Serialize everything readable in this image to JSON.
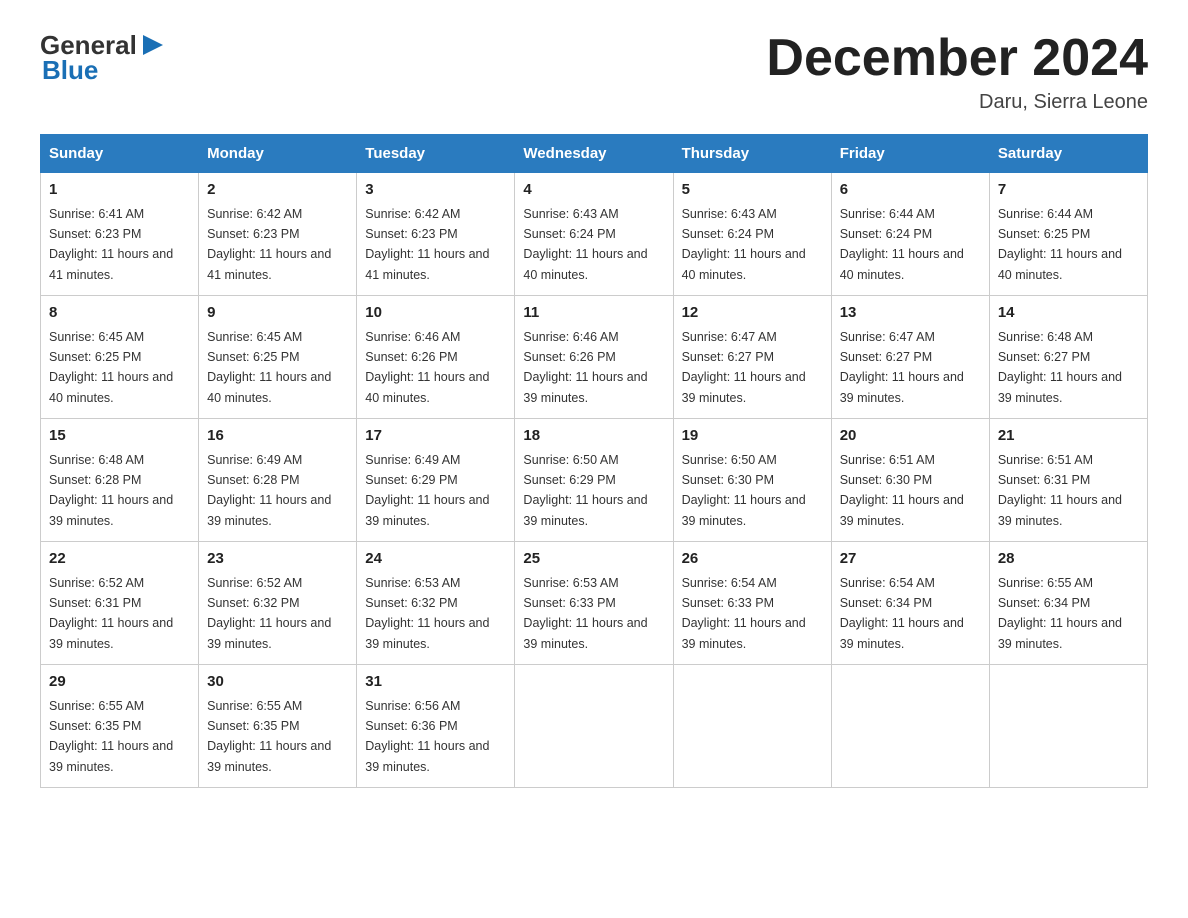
{
  "logo": {
    "general": "General",
    "blue": "Blue",
    "arrow": "▶"
  },
  "title": "December 2024",
  "location": "Daru, Sierra Leone",
  "days_of_week": [
    "Sunday",
    "Monday",
    "Tuesday",
    "Wednesday",
    "Thursday",
    "Friday",
    "Saturday"
  ],
  "weeks": [
    [
      {
        "day": "1",
        "sunrise": "6:41 AM",
        "sunset": "6:23 PM",
        "daylight": "11 hours and 41 minutes."
      },
      {
        "day": "2",
        "sunrise": "6:42 AM",
        "sunset": "6:23 PM",
        "daylight": "11 hours and 41 minutes."
      },
      {
        "day": "3",
        "sunrise": "6:42 AM",
        "sunset": "6:23 PM",
        "daylight": "11 hours and 41 minutes."
      },
      {
        "day": "4",
        "sunrise": "6:43 AM",
        "sunset": "6:24 PM",
        "daylight": "11 hours and 40 minutes."
      },
      {
        "day": "5",
        "sunrise": "6:43 AM",
        "sunset": "6:24 PM",
        "daylight": "11 hours and 40 minutes."
      },
      {
        "day": "6",
        "sunrise": "6:44 AM",
        "sunset": "6:24 PM",
        "daylight": "11 hours and 40 minutes."
      },
      {
        "day": "7",
        "sunrise": "6:44 AM",
        "sunset": "6:25 PM",
        "daylight": "11 hours and 40 minutes."
      }
    ],
    [
      {
        "day": "8",
        "sunrise": "6:45 AM",
        "sunset": "6:25 PM",
        "daylight": "11 hours and 40 minutes."
      },
      {
        "day": "9",
        "sunrise": "6:45 AM",
        "sunset": "6:25 PM",
        "daylight": "11 hours and 40 minutes."
      },
      {
        "day": "10",
        "sunrise": "6:46 AM",
        "sunset": "6:26 PM",
        "daylight": "11 hours and 40 minutes."
      },
      {
        "day": "11",
        "sunrise": "6:46 AM",
        "sunset": "6:26 PM",
        "daylight": "11 hours and 39 minutes."
      },
      {
        "day": "12",
        "sunrise": "6:47 AM",
        "sunset": "6:27 PM",
        "daylight": "11 hours and 39 minutes."
      },
      {
        "day": "13",
        "sunrise": "6:47 AM",
        "sunset": "6:27 PM",
        "daylight": "11 hours and 39 minutes."
      },
      {
        "day": "14",
        "sunrise": "6:48 AM",
        "sunset": "6:27 PM",
        "daylight": "11 hours and 39 minutes."
      }
    ],
    [
      {
        "day": "15",
        "sunrise": "6:48 AM",
        "sunset": "6:28 PM",
        "daylight": "11 hours and 39 minutes."
      },
      {
        "day": "16",
        "sunrise": "6:49 AM",
        "sunset": "6:28 PM",
        "daylight": "11 hours and 39 minutes."
      },
      {
        "day": "17",
        "sunrise": "6:49 AM",
        "sunset": "6:29 PM",
        "daylight": "11 hours and 39 minutes."
      },
      {
        "day": "18",
        "sunrise": "6:50 AM",
        "sunset": "6:29 PM",
        "daylight": "11 hours and 39 minutes."
      },
      {
        "day": "19",
        "sunrise": "6:50 AM",
        "sunset": "6:30 PM",
        "daylight": "11 hours and 39 minutes."
      },
      {
        "day": "20",
        "sunrise": "6:51 AM",
        "sunset": "6:30 PM",
        "daylight": "11 hours and 39 minutes."
      },
      {
        "day": "21",
        "sunrise": "6:51 AM",
        "sunset": "6:31 PM",
        "daylight": "11 hours and 39 minutes."
      }
    ],
    [
      {
        "day": "22",
        "sunrise": "6:52 AM",
        "sunset": "6:31 PM",
        "daylight": "11 hours and 39 minutes."
      },
      {
        "day": "23",
        "sunrise": "6:52 AM",
        "sunset": "6:32 PM",
        "daylight": "11 hours and 39 minutes."
      },
      {
        "day": "24",
        "sunrise": "6:53 AM",
        "sunset": "6:32 PM",
        "daylight": "11 hours and 39 minutes."
      },
      {
        "day": "25",
        "sunrise": "6:53 AM",
        "sunset": "6:33 PM",
        "daylight": "11 hours and 39 minutes."
      },
      {
        "day": "26",
        "sunrise": "6:54 AM",
        "sunset": "6:33 PM",
        "daylight": "11 hours and 39 minutes."
      },
      {
        "day": "27",
        "sunrise": "6:54 AM",
        "sunset": "6:34 PM",
        "daylight": "11 hours and 39 minutes."
      },
      {
        "day": "28",
        "sunrise": "6:55 AM",
        "sunset": "6:34 PM",
        "daylight": "11 hours and 39 minutes."
      }
    ],
    [
      {
        "day": "29",
        "sunrise": "6:55 AM",
        "sunset": "6:35 PM",
        "daylight": "11 hours and 39 minutes."
      },
      {
        "day": "30",
        "sunrise": "6:55 AM",
        "sunset": "6:35 PM",
        "daylight": "11 hours and 39 minutes."
      },
      {
        "day": "31",
        "sunrise": "6:56 AM",
        "sunset": "6:36 PM",
        "daylight": "11 hours and 39 minutes."
      },
      null,
      null,
      null,
      null
    ]
  ]
}
